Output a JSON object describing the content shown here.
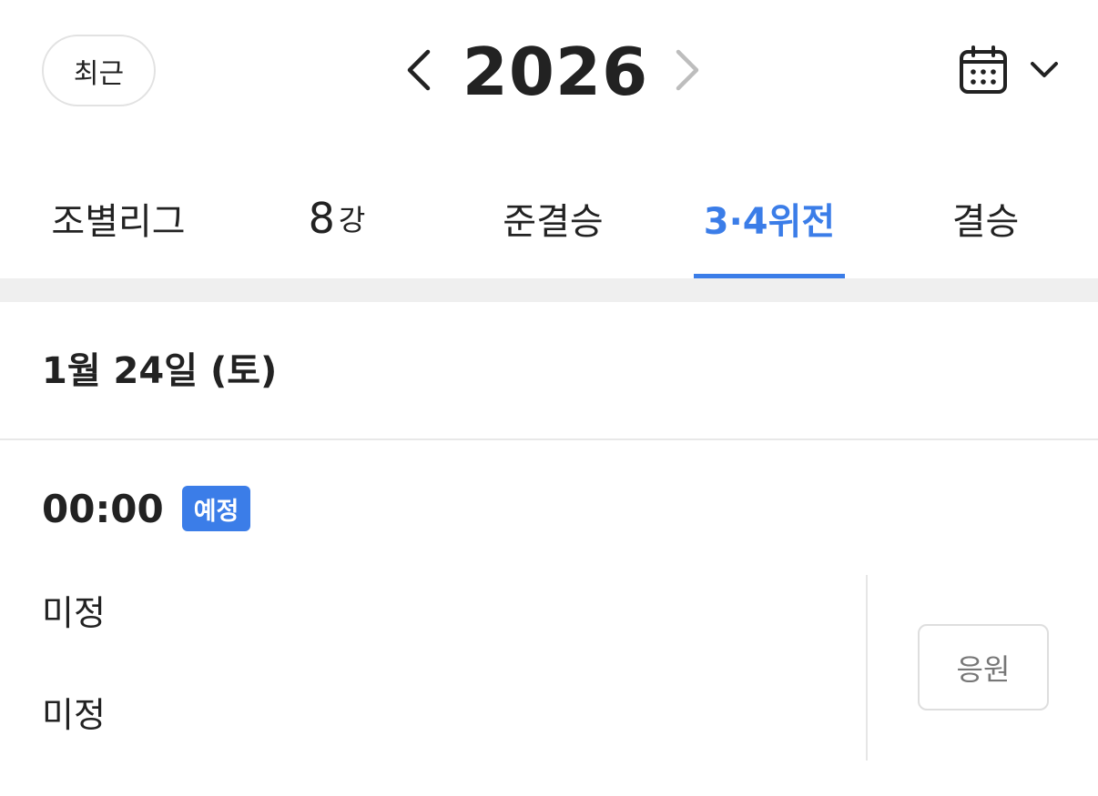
{
  "header": {
    "recent_label": "최근",
    "year": "2026",
    "prev_icon": "chevron-left-icon",
    "next_icon": "chevron-right-icon",
    "calendar_icon": "calendar-icon",
    "dropdown_icon": "chevron-down-icon"
  },
  "tabs": [
    {
      "label": "조별리그",
      "active": false
    },
    {
      "label_big": "8",
      "label_small": "강",
      "active": false
    },
    {
      "label": "준결승",
      "active": false
    },
    {
      "label": "3·4위전",
      "active": true
    },
    {
      "label": "결승",
      "active": false
    }
  ],
  "colors": {
    "accent": "#3b7de8",
    "text": "#222222",
    "muted": "#777777",
    "band": "#efefef"
  },
  "schedule": {
    "date": "1월 24일 (토)",
    "match": {
      "time": "00:00",
      "status": "예정",
      "team1": "미정",
      "team2": "미정",
      "cheer_label": "응원"
    }
  }
}
